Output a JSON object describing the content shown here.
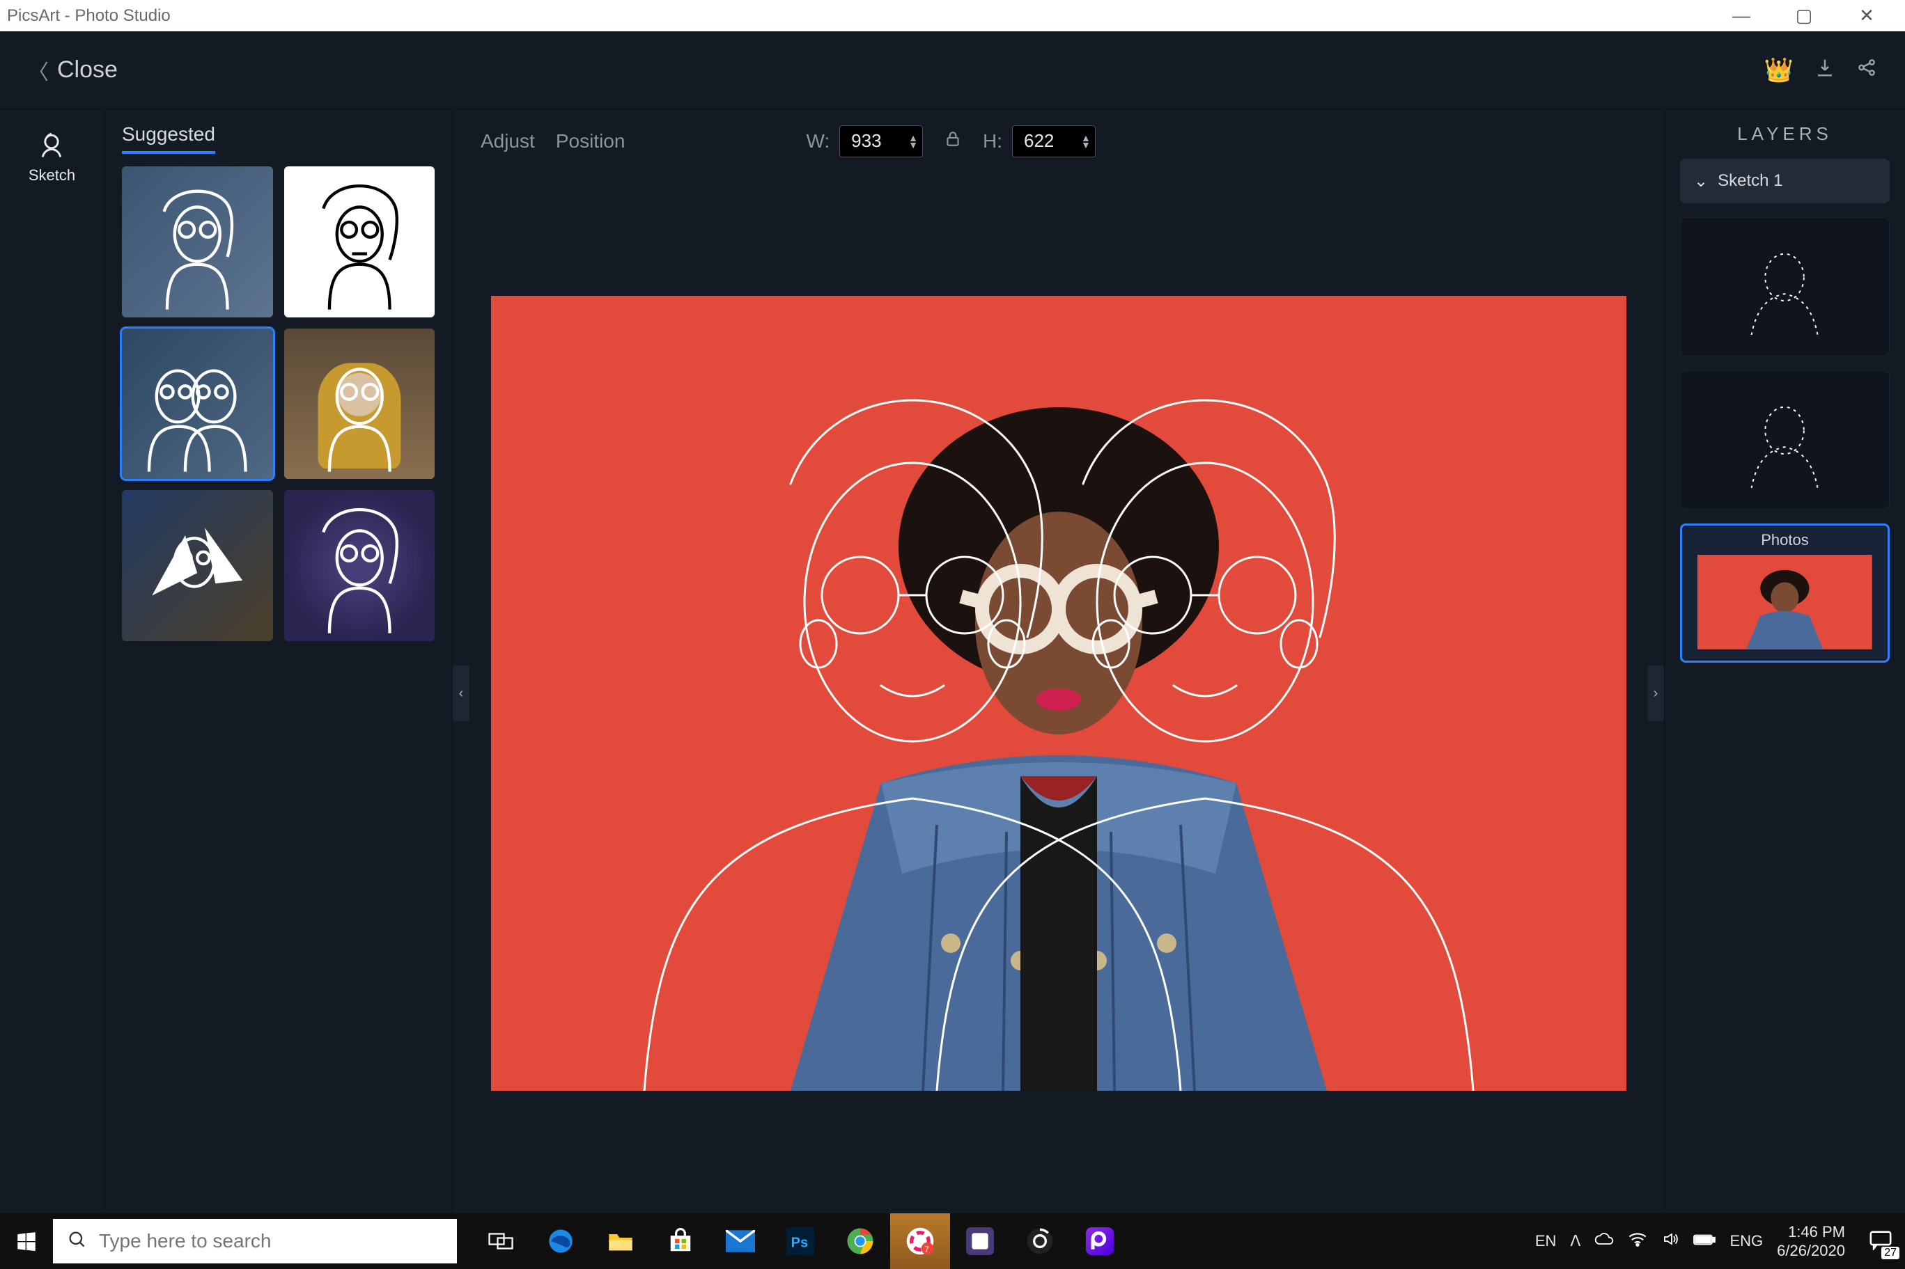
{
  "titlebar": {
    "title": "PicsArt - Photo Studio"
  },
  "header": {
    "close": "Close"
  },
  "rail": {
    "sketch": "Sketch"
  },
  "suggested": {
    "title": "Suggested",
    "selected_index": 2
  },
  "toolbar": {
    "adjust": "Adjust",
    "position": "Position",
    "w_label": "W:",
    "h_label": "H:",
    "width": "933",
    "height": "622"
  },
  "layers": {
    "title": "LAYERS",
    "sketch_layer": "Sketch 1",
    "photos_layer": "Photos"
  },
  "taskbar": {
    "search_placeholder": "Type here to search",
    "lang1": "EN",
    "lang2": "ENG",
    "time": "1:46 PM",
    "date": "6/26/2020",
    "notif_badge": "27"
  }
}
